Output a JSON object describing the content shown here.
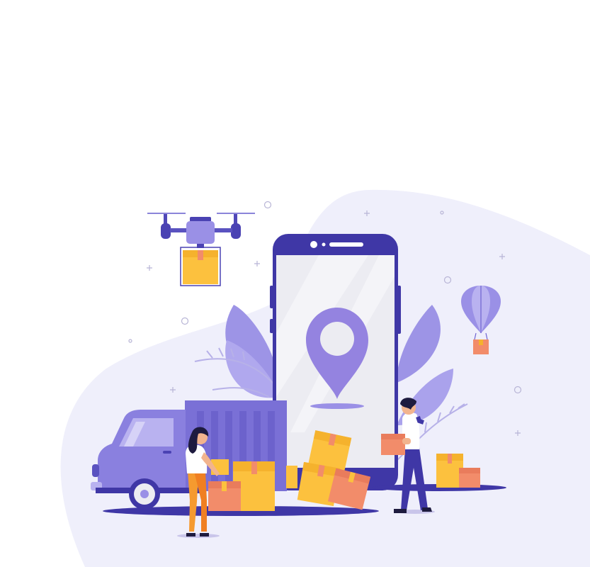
{
  "illustration": {
    "subject": "delivery-logistics",
    "elements": [
      "drone-icon",
      "parcel-icon",
      "smartphone-icon",
      "location-pin-icon",
      "hot-air-balloon-icon",
      "delivery-truck-icon",
      "courier-woman",
      "courier-man"
    ],
    "colors": {
      "background": "#ffffff",
      "blob": "#efeffb",
      "purple_dark": "#3f37a6",
      "purple_mid": "#6f63d3",
      "purple_light": "#9a90e6",
      "lavender": "#b9b2f0",
      "box_yellow": "#fcc13e",
      "box_orange": "#f28c6a",
      "screen": "#ececf2",
      "skin": "#f2b48e",
      "hair": "#1e1b3f",
      "pants_orange": "#f59a2f"
    }
  }
}
